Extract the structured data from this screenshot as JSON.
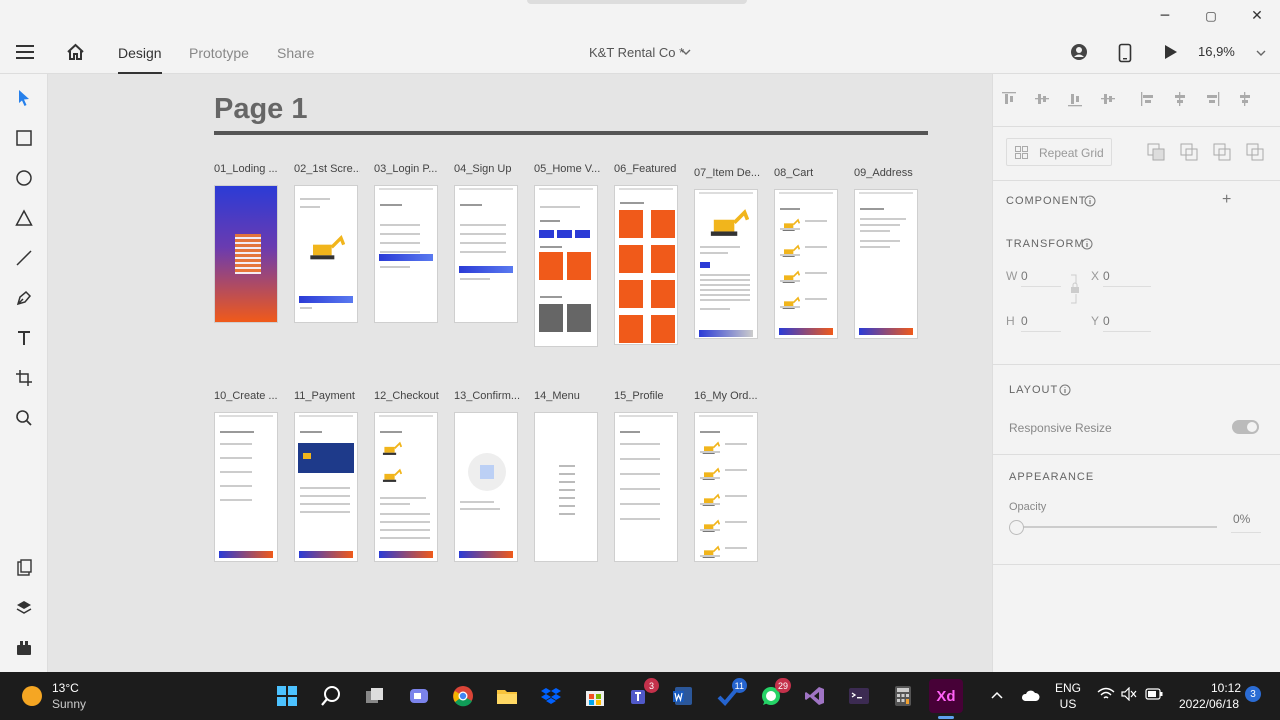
{
  "window": {
    "minimize": "─",
    "maximize": "▢",
    "close": "✕"
  },
  "topbar": {
    "tabs": [
      "Design",
      "Prototype",
      "Share"
    ],
    "active_tab": "Design",
    "doc_title": "K&T Rental Co *",
    "zoom": "16,9%"
  },
  "canvas": {
    "page_title": "Page 1",
    "artboards": [
      {
        "label": "01_Loding ...",
        "kind": "loading"
      },
      {
        "label": "02_1st Scre...",
        "kind": "welcome"
      },
      {
        "label": "03_Login P...",
        "kind": "login"
      },
      {
        "label": "04_Sign Up",
        "kind": "signup"
      },
      {
        "label": "05_Home V...",
        "kind": "home"
      },
      {
        "label": "06_Featured",
        "kind": "featured"
      },
      {
        "label": "07_Item De...",
        "kind": "item"
      },
      {
        "label": "08_Cart",
        "kind": "cart"
      },
      {
        "label": "09_Address",
        "kind": "address"
      },
      {
        "label": "10_Create ...",
        "kind": "form"
      },
      {
        "label": "11_Payment",
        "kind": "payment"
      },
      {
        "label": "12_Checkout",
        "kind": "checkout"
      },
      {
        "label": "13_Confirm...",
        "kind": "confirm"
      },
      {
        "label": "14_Menu",
        "kind": "menu"
      },
      {
        "label": "15_Profile",
        "kind": "profile"
      },
      {
        "label": "16_My Ord...",
        "kind": "orders"
      }
    ]
  },
  "panel": {
    "repeat_grid": "Repeat Grid",
    "component": "COMPONENT",
    "transform": "TRANSFORM",
    "w_label": "W",
    "w_val": "0",
    "x_label": "X",
    "x_val": "0",
    "h_label": "H",
    "h_val": "0",
    "y_label": "Y",
    "y_val": "0",
    "layout": "LAYOUT",
    "responsive_resize": "Responsive Resize",
    "appearance": "APPEARANCE",
    "opacity_label": "Opacity",
    "opacity_val": "0%"
  },
  "taskbar": {
    "weather_temp": "13°C",
    "weather_desc": "Sunny",
    "lang1": "ENG",
    "lang2": "US",
    "time": "10:12",
    "date": "2022/06/18",
    "notif_count": "3",
    "badges": {
      "teams": "3",
      "todo": "11",
      "whatsapp": "29"
    }
  },
  "colors": {
    "accent_blue": "#2b3bd6",
    "accent_orange": "#f05a1a",
    "xd_pink": "#ff61f6",
    "xd_bg": "#470137"
  }
}
